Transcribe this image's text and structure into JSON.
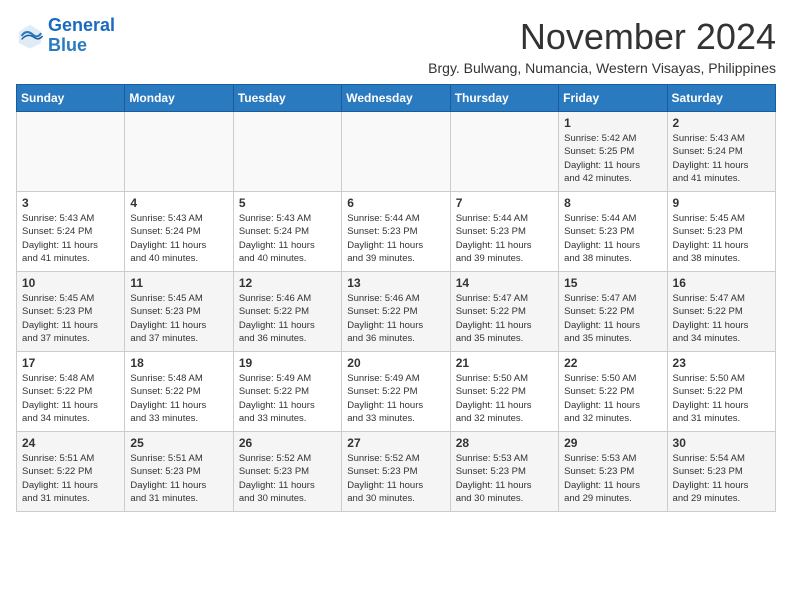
{
  "header": {
    "logo_line1": "General",
    "logo_line2": "Blue",
    "month": "November 2024",
    "location": "Brgy. Bulwang, Numancia, Western Visayas, Philippines"
  },
  "weekdays": [
    "Sunday",
    "Monday",
    "Tuesday",
    "Wednesday",
    "Thursday",
    "Friday",
    "Saturday"
  ],
  "weeks": [
    [
      {
        "day": "",
        "info": ""
      },
      {
        "day": "",
        "info": ""
      },
      {
        "day": "",
        "info": ""
      },
      {
        "day": "",
        "info": ""
      },
      {
        "day": "",
        "info": ""
      },
      {
        "day": "1",
        "info": "Sunrise: 5:42 AM\nSunset: 5:25 PM\nDaylight: 11 hours\nand 42 minutes."
      },
      {
        "day": "2",
        "info": "Sunrise: 5:43 AM\nSunset: 5:24 PM\nDaylight: 11 hours\nand 41 minutes."
      }
    ],
    [
      {
        "day": "3",
        "info": "Sunrise: 5:43 AM\nSunset: 5:24 PM\nDaylight: 11 hours\nand 41 minutes."
      },
      {
        "day": "4",
        "info": "Sunrise: 5:43 AM\nSunset: 5:24 PM\nDaylight: 11 hours\nand 40 minutes."
      },
      {
        "day": "5",
        "info": "Sunrise: 5:43 AM\nSunset: 5:24 PM\nDaylight: 11 hours\nand 40 minutes."
      },
      {
        "day": "6",
        "info": "Sunrise: 5:44 AM\nSunset: 5:23 PM\nDaylight: 11 hours\nand 39 minutes."
      },
      {
        "day": "7",
        "info": "Sunrise: 5:44 AM\nSunset: 5:23 PM\nDaylight: 11 hours\nand 39 minutes."
      },
      {
        "day": "8",
        "info": "Sunrise: 5:44 AM\nSunset: 5:23 PM\nDaylight: 11 hours\nand 38 minutes."
      },
      {
        "day": "9",
        "info": "Sunrise: 5:45 AM\nSunset: 5:23 PM\nDaylight: 11 hours\nand 38 minutes."
      }
    ],
    [
      {
        "day": "10",
        "info": "Sunrise: 5:45 AM\nSunset: 5:23 PM\nDaylight: 11 hours\nand 37 minutes."
      },
      {
        "day": "11",
        "info": "Sunrise: 5:45 AM\nSunset: 5:23 PM\nDaylight: 11 hours\nand 37 minutes."
      },
      {
        "day": "12",
        "info": "Sunrise: 5:46 AM\nSunset: 5:22 PM\nDaylight: 11 hours\nand 36 minutes."
      },
      {
        "day": "13",
        "info": "Sunrise: 5:46 AM\nSunset: 5:22 PM\nDaylight: 11 hours\nand 36 minutes."
      },
      {
        "day": "14",
        "info": "Sunrise: 5:47 AM\nSunset: 5:22 PM\nDaylight: 11 hours\nand 35 minutes."
      },
      {
        "day": "15",
        "info": "Sunrise: 5:47 AM\nSunset: 5:22 PM\nDaylight: 11 hours\nand 35 minutes."
      },
      {
        "day": "16",
        "info": "Sunrise: 5:47 AM\nSunset: 5:22 PM\nDaylight: 11 hours\nand 34 minutes."
      }
    ],
    [
      {
        "day": "17",
        "info": "Sunrise: 5:48 AM\nSunset: 5:22 PM\nDaylight: 11 hours\nand 34 minutes."
      },
      {
        "day": "18",
        "info": "Sunrise: 5:48 AM\nSunset: 5:22 PM\nDaylight: 11 hours\nand 33 minutes."
      },
      {
        "day": "19",
        "info": "Sunrise: 5:49 AM\nSunset: 5:22 PM\nDaylight: 11 hours\nand 33 minutes."
      },
      {
        "day": "20",
        "info": "Sunrise: 5:49 AM\nSunset: 5:22 PM\nDaylight: 11 hours\nand 33 minutes."
      },
      {
        "day": "21",
        "info": "Sunrise: 5:50 AM\nSunset: 5:22 PM\nDaylight: 11 hours\nand 32 minutes."
      },
      {
        "day": "22",
        "info": "Sunrise: 5:50 AM\nSunset: 5:22 PM\nDaylight: 11 hours\nand 32 minutes."
      },
      {
        "day": "23",
        "info": "Sunrise: 5:50 AM\nSunset: 5:22 PM\nDaylight: 11 hours\nand 31 minutes."
      }
    ],
    [
      {
        "day": "24",
        "info": "Sunrise: 5:51 AM\nSunset: 5:22 PM\nDaylight: 11 hours\nand 31 minutes."
      },
      {
        "day": "25",
        "info": "Sunrise: 5:51 AM\nSunset: 5:23 PM\nDaylight: 11 hours\nand 31 minutes."
      },
      {
        "day": "26",
        "info": "Sunrise: 5:52 AM\nSunset: 5:23 PM\nDaylight: 11 hours\nand 30 minutes."
      },
      {
        "day": "27",
        "info": "Sunrise: 5:52 AM\nSunset: 5:23 PM\nDaylight: 11 hours\nand 30 minutes."
      },
      {
        "day": "28",
        "info": "Sunrise: 5:53 AM\nSunset: 5:23 PM\nDaylight: 11 hours\nand 30 minutes."
      },
      {
        "day": "29",
        "info": "Sunrise: 5:53 AM\nSunset: 5:23 PM\nDaylight: 11 hours\nand 29 minutes."
      },
      {
        "day": "30",
        "info": "Sunrise: 5:54 AM\nSunset: 5:23 PM\nDaylight: 11 hours\nand 29 minutes."
      }
    ]
  ]
}
